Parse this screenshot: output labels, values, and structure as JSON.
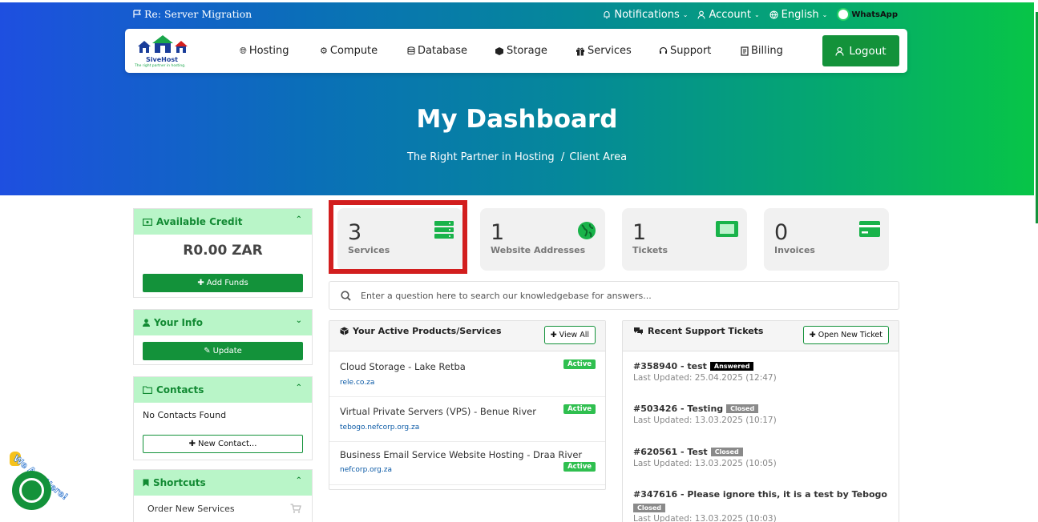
{
  "topbar": {
    "title": "Re: Server Migration",
    "notifications": "Notifications",
    "account": "Account",
    "language": "English",
    "whatsapp": "WhatsApp"
  },
  "brand": {
    "name": "SiveHost",
    "tagline": "The right partner in hosting."
  },
  "nav": {
    "items": [
      "Hosting",
      "Compute",
      "Database",
      "Storage",
      "Services",
      "Support",
      "Billing"
    ],
    "logout": "Logout"
  },
  "hero": {
    "title": "My Dashboard",
    "crumb1": "The Right Partner in Hosting",
    "crumb_sep": "/",
    "crumb2": "Client Area"
  },
  "sidebar": {
    "credit": {
      "title": "Available Credit",
      "amount": "R0.00 ZAR",
      "button": "Add Funds"
    },
    "info": {
      "title": "Your Info",
      "button": "Update"
    },
    "contacts": {
      "title": "Contacts",
      "empty": "No Contacts Found",
      "button": "New Contact..."
    },
    "shortcuts": {
      "title": "Shortcuts",
      "item1": "Order New Services"
    }
  },
  "stats": [
    {
      "count": "3",
      "label": "Services"
    },
    {
      "count": "1",
      "label": "Website Addresses"
    },
    {
      "count": "1",
      "label": "Tickets"
    },
    {
      "count": "0",
      "label": "Invoices"
    }
  ],
  "search": {
    "placeholder": "Enter a question here to search our knowledgebase for answers..."
  },
  "products": {
    "title": "Your Active Products/Services",
    "button": "View All",
    "rows": [
      {
        "name": "Cloud Storage - Lake Retba",
        "domain": "rele.co.za",
        "status": "Active"
      },
      {
        "name": "Virtual Private Servers (VPS) - Benue River",
        "domain": "tebogo.nefcorp.org.za",
        "status": "Active"
      },
      {
        "name": "Business Email Service Website Hosting - Draa River",
        "domain": "nefcorp.org.za",
        "status": "Active"
      }
    ]
  },
  "tickets": {
    "title": "Recent Support Tickets",
    "button": "Open New Ticket",
    "rows": [
      {
        "title": "#358940 - test",
        "status": "Answered",
        "updated": "Last Updated: 25.04.2025 (12:47)"
      },
      {
        "title": "#503426 - Testing",
        "status": "Closed",
        "updated": "Last Updated: 13.03.2025 (10:17)"
      },
      {
        "title": "#620561 - Test",
        "status": "Closed",
        "updated": "Last Updated: 13.03.2025 (10:05)"
      },
      {
        "title": "#347616 - Please ignore this, it is a test by Tebogo",
        "status": "Closed",
        "updated": "Last Updated: 13.03.2025 (10:03)"
      }
    ]
  },
  "chat": {
    "label": "We Are Here!"
  },
  "colors": {
    "brand_green": "#13923a",
    "panel_head": "#b9f5c8",
    "highlight": "#d21e1e"
  }
}
